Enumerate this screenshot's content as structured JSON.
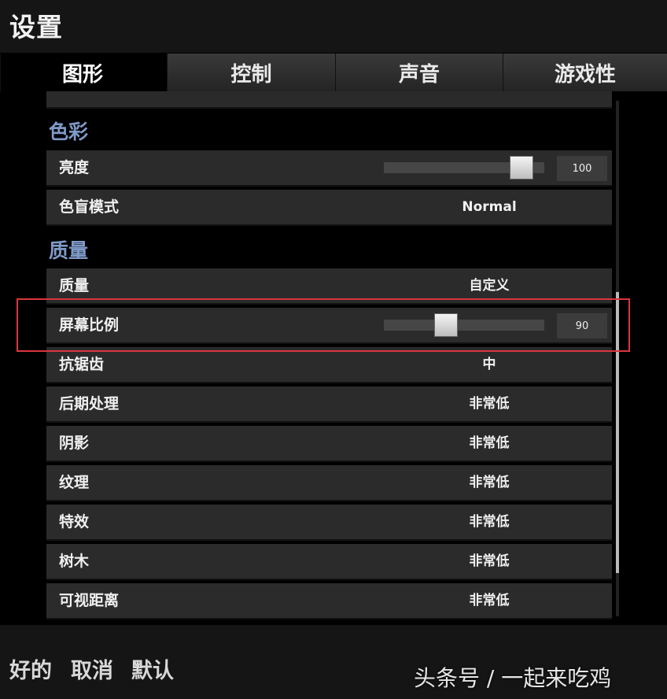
{
  "window": {
    "title": "设置"
  },
  "tabs": [
    {
      "label": "图形",
      "active": true
    },
    {
      "label": "控制",
      "active": false
    },
    {
      "label": "声音",
      "active": false
    },
    {
      "label": "游戏性",
      "active": false
    }
  ],
  "sections": {
    "color": {
      "header": "色彩",
      "brightness": {
        "label": "亮度",
        "value": "100",
        "level": 1.0
      },
      "colorblind": {
        "label": "色盲模式",
        "value": "Normal"
      }
    },
    "quality": {
      "header": "质量",
      "quality": {
        "label": "质量",
        "value": "自定义"
      },
      "screen_scale": {
        "label": "屏幕比例",
        "value": "90",
        "level": 0.4
      },
      "anti_aliasing": {
        "label": "抗锯齿",
        "value": "中"
      },
      "post_processing": {
        "label": "后期处理",
        "value": "非常低"
      },
      "shadows": {
        "label": "阴影",
        "value": "非常低"
      },
      "textures": {
        "label": "纹理",
        "value": "非常低"
      },
      "effects": {
        "label": "特效",
        "value": "非常低"
      },
      "foliage": {
        "label": "树木",
        "value": "非常低"
      },
      "view_distance": {
        "label": "可视距离",
        "value": "非常低"
      }
    }
  },
  "footer": {
    "ok": "好的",
    "cancel": "取消",
    "default": "默认"
  },
  "watermark": "头条号 / 一起来吃鸡",
  "colors": {
    "section_header": "#7f9ac8",
    "highlight_box": "#d9363e",
    "row_bg": "#2b2b2b"
  }
}
